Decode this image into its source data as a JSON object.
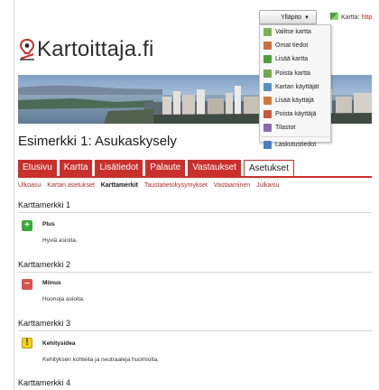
{
  "topbar": {
    "admin_label": "Ylläpito",
    "caret": "▼",
    "map_link_label": "Kartta:",
    "map_link_url": "http"
  },
  "dropdown": {
    "items": [
      {
        "label": "Valitse kartta",
        "icon": "map-select-icon",
        "color": "#7cb35a"
      },
      {
        "label": "Omat tiedot",
        "icon": "user-icon",
        "color": "#c9703a"
      },
      {
        "label": "Lisää kartta",
        "icon": "map-add-icon",
        "color": "#4f9e3b"
      },
      {
        "label": "Poista kartta",
        "icon": "map-remove-icon",
        "color": "#6fa84d"
      },
      {
        "label": "Kartan käyttäjät",
        "icon": "map-users-icon",
        "color": "#5a8fc2"
      },
      {
        "label": "Lisää käyttäjä",
        "icon": "user-add-icon",
        "color": "#d07a3a"
      },
      {
        "label": "Poista käyttäjä",
        "icon": "user-remove-icon",
        "color": "#c9583a"
      },
      {
        "label": "Tilastot",
        "icon": "stats-icon",
        "color": "#8a6bb0"
      },
      {
        "label": "Laskutustiedot",
        "icon": "billing-icon",
        "color": "#4a7fc0"
      }
    ]
  },
  "logo": {
    "text": "Kartoittaja.fi"
  },
  "page": {
    "title": "Esimerkki 1: Asukaskysely"
  },
  "tabs": [
    {
      "label": "Etusivu",
      "active": false
    },
    {
      "label": "Kartta",
      "active": false
    },
    {
      "label": "Lisätiedot",
      "active": false
    },
    {
      "label": "Palaute",
      "active": false
    },
    {
      "label": "Vastaukset",
      "active": false
    },
    {
      "label": "Asetukset",
      "active": true
    }
  ],
  "subnav": [
    {
      "label": "Ulkoasu",
      "active": false
    },
    {
      "label": "Kartan asetukset",
      "active": false
    },
    {
      "label": "Karttamerkit",
      "active": true
    },
    {
      "label": "Taustatietokysymykset",
      "active": false
    },
    {
      "label": "Vastaaminen",
      "active": false
    },
    {
      "label": "Julkaisu",
      "active": false
    }
  ],
  "markers": [
    {
      "heading": "Karttamerkki 1",
      "name": "Plus",
      "description": "Hyviä asioita.",
      "symbol": "+",
      "color": "#3aa83a",
      "icon": "plus-marker-icon"
    },
    {
      "heading": "Karttamerkki 2",
      "name": "Miinus",
      "description": "Huonoja asioita.",
      "symbol": "−",
      "color": "#d9534f",
      "icon": "minus-marker-icon"
    },
    {
      "heading": "Karttamerkki 3",
      "name": "Kehitysidea",
      "description": "Kehityksen kohteita ja neutraaleja huomioita.",
      "symbol": "!",
      "color": "#f2d21a",
      "icon": "idea-marker-icon"
    },
    {
      "heading": "Karttamerkki 4"
    }
  ]
}
